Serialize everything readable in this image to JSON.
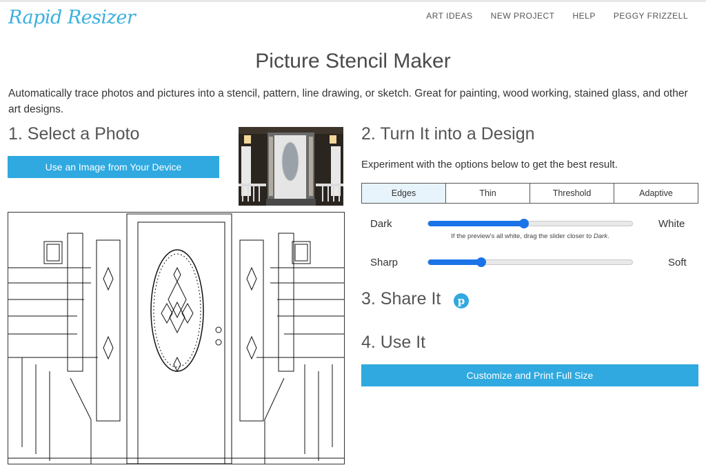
{
  "header": {
    "logo": "Rapid Resizer",
    "nav": [
      "ART IDEAS",
      "NEW PROJECT",
      "HELP",
      "PEGGY FRIZZELL"
    ]
  },
  "page": {
    "title": "Picture Stencil Maker",
    "intro": "Automatically trace photos and pictures into a stencil, pattern, line drawing, or sketch. Great for painting, wood working, stained glass, and other art designs."
  },
  "step1": {
    "heading": "1. Select a Photo",
    "button": "Use an Image from Your Device"
  },
  "step2": {
    "heading": "2. Turn It into a Design",
    "subtext": "Experiment with the options below to get the best result.",
    "tabs": [
      {
        "label": "Edges",
        "active": true
      },
      {
        "label": "Thin",
        "active": false
      },
      {
        "label": "Threshold",
        "active": false
      },
      {
        "label": "Adaptive",
        "active": false
      }
    ],
    "sliders": [
      {
        "left_label": "Dark",
        "right_label": "White",
        "value_pct": 47
      },
      {
        "left_label": "Sharp",
        "right_label": "Soft",
        "value_pct": 26
      }
    ],
    "hint_prefix": "If the preview's all white, drag the slider closer to ",
    "hint_emph": "Dark",
    "hint_suffix": "."
  },
  "step3": {
    "heading": "3. Share It",
    "share_icon": "pinterest-icon"
  },
  "step4": {
    "heading": "4. Use It",
    "button": "Customize and Print Full Size"
  },
  "colors": {
    "accent": "#2fa9e0",
    "slider": "#1a73e8",
    "active_tab": "#e8f4fc"
  }
}
